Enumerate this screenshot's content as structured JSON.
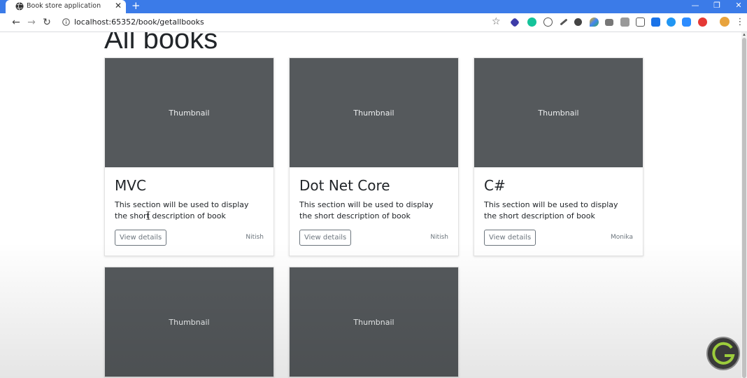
{
  "browser": {
    "tab_title": "Book store application",
    "tab_close": "✕",
    "new_tab": "+",
    "url": "localhost:65352/book/getallbooks",
    "window_controls": [
      "—",
      "❐",
      "✕"
    ]
  },
  "page": {
    "title": "All books",
    "books": [
      {
        "thumbnail": "Thumbnail",
        "title": "MVC",
        "description": "This section will be used to display the short description of book",
        "button": "View details",
        "author": "Nitish"
      },
      {
        "thumbnail": "Thumbnail",
        "title": "Dot Net Core",
        "description": "This section will be used to display the short description of book",
        "button": "View details",
        "author": "Nitish"
      },
      {
        "thumbnail": "Thumbnail",
        "title": "C#",
        "description": "This section will be used to display the short description of book",
        "button": "View details",
        "author": "Monika"
      },
      {
        "thumbnail": "Thumbnail"
      },
      {
        "thumbnail": "Thumbnail"
      }
    ]
  },
  "extensions": [
    "extension-icon-1",
    "extension-icon-2",
    "extension-icon-3",
    "extension-icon-4",
    "extension-icon-5",
    "extension-icon-6",
    "extension-icon-7",
    "extension-icon-8",
    "extension-icon-9",
    "extension-icon-10",
    "extension-icon-11",
    "extension-icon-12",
    "extension-icon-13",
    "extension-icon-14"
  ],
  "colors": {
    "tabbar": "#3b7be8",
    "thumbnail": "#55595c",
    "button_border": "#6c757d"
  }
}
